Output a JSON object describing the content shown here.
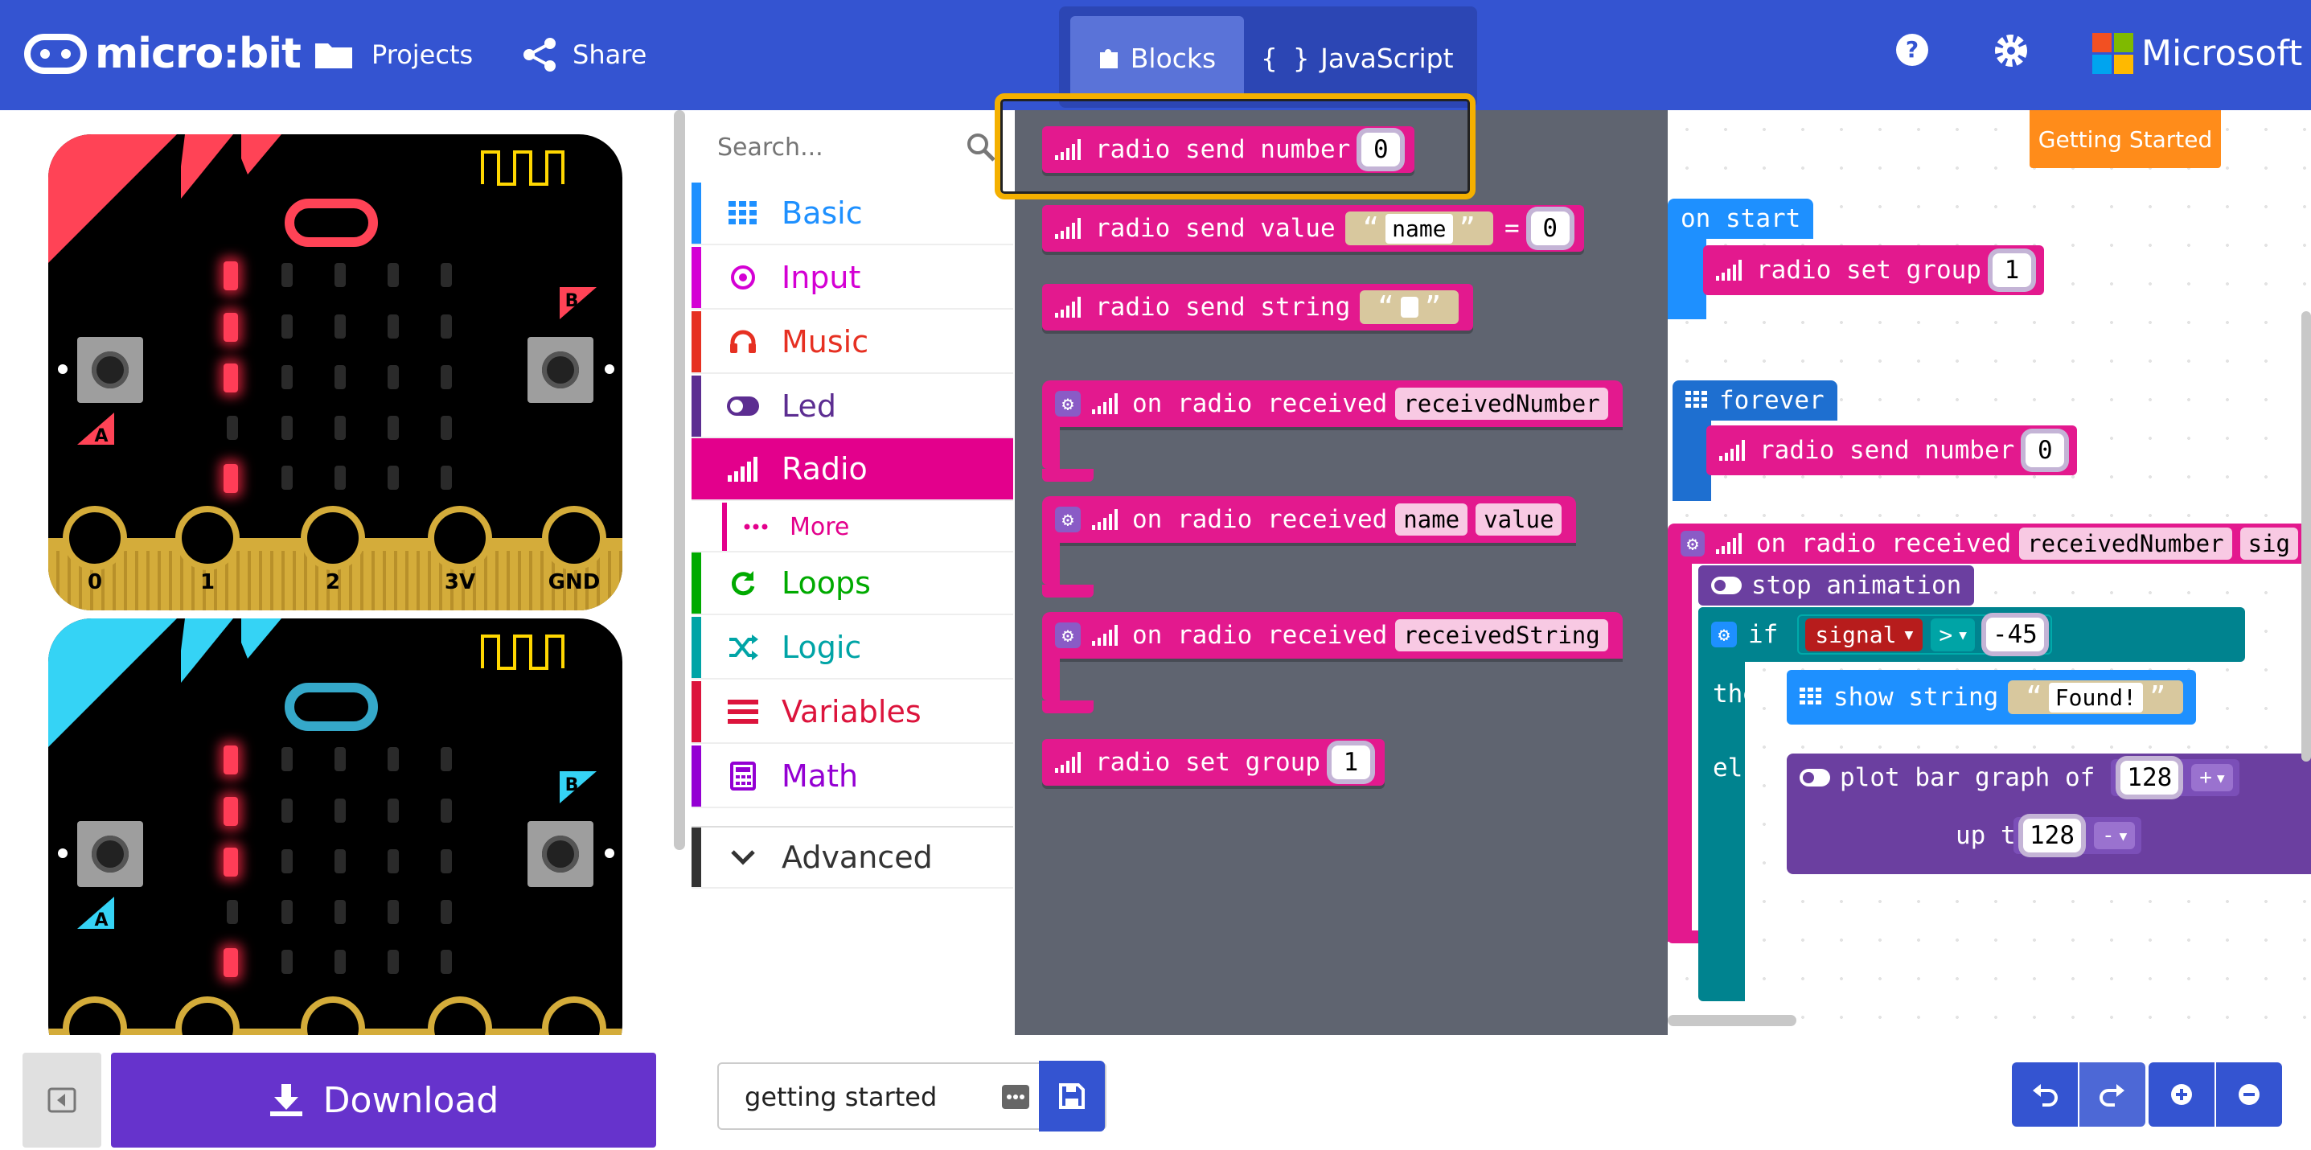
{
  "header": {
    "logo_text": "micro:bit",
    "nav_projects": "Projects",
    "nav_share": "Share",
    "tab_blocks": "Blocks",
    "tab_js": "JavaScript",
    "ms_text": "Microsoft"
  },
  "simulator": {
    "pins": [
      "0",
      "1",
      "2",
      "3V",
      "GND"
    ],
    "button_a": "A",
    "button_b": "B",
    "board_1_color": "#ff4356",
    "board_2_color": "#35d3f5"
  },
  "toolbox": {
    "search_placeholder": "Search...",
    "categories": [
      {
        "label": "Basic",
        "color": "#1e90ff",
        "icon": "grid-icon"
      },
      {
        "label": "Input",
        "color": "#d400d4",
        "icon": "target-icon"
      },
      {
        "label": "Music",
        "color": "#e63022",
        "icon": "headphones-icon"
      },
      {
        "label": "Led",
        "color": "#5c2d91",
        "icon": "toggle-icon"
      },
      {
        "label": "Radio",
        "color": "#e3008c",
        "icon": "signal-icon"
      },
      {
        "label": "More",
        "color": "#e3008c",
        "icon": "dots-icon"
      },
      {
        "label": "Loops",
        "color": "#00aa00",
        "icon": "refresh-icon"
      },
      {
        "label": "Logic",
        "color": "#00a4a6",
        "icon": "shuffle-icon"
      },
      {
        "label": "Variables",
        "color": "#dc143c",
        "icon": "list-icon"
      },
      {
        "label": "Math",
        "color": "#9400d3",
        "icon": "calculator-icon"
      },
      {
        "label": "Advanced",
        "color": "#333333",
        "icon": "chevron-down-icon"
      }
    ]
  },
  "flyout": {
    "radio_send_number": "radio send number",
    "radio_send_number_val": "0",
    "radio_send_value": "radio send value",
    "radio_send_value_name": "name",
    "radio_send_value_eq": "=",
    "radio_send_value_val": "0",
    "radio_send_string": "radio send string",
    "on_radio_received": "on radio received",
    "received_number": "receivedNumber",
    "name_var": "name",
    "value_var": "value",
    "received_string": "receivedString",
    "radio_set_group": "radio set group",
    "radio_set_group_val": "1"
  },
  "workspace": {
    "getting_started": "Getting Started",
    "on_start": "on start",
    "ws_set_group": "radio set group",
    "ws_set_group_val": "1",
    "forever": "forever",
    "ws_send_number": "radio send number",
    "ws_send_number_val": "0",
    "on_radio_received": "on radio received",
    "received_number": "receivedNumber",
    "sig_cut": "sig",
    "stop_animation": "stop animation",
    "if_label": "if",
    "signal": "signal",
    "op_gt": ">",
    "neg45": "-45",
    "then_label": "then",
    "show_string": "show string",
    "found": "Found!",
    "else_label": "else",
    "plot_bar_graph": "plot bar graph of",
    "val_128a": "128",
    "plus": "+",
    "up_to": "up to",
    "val_128b": "128",
    "minus": "-"
  },
  "bottom": {
    "download": "Download",
    "project_name": "getting started"
  }
}
